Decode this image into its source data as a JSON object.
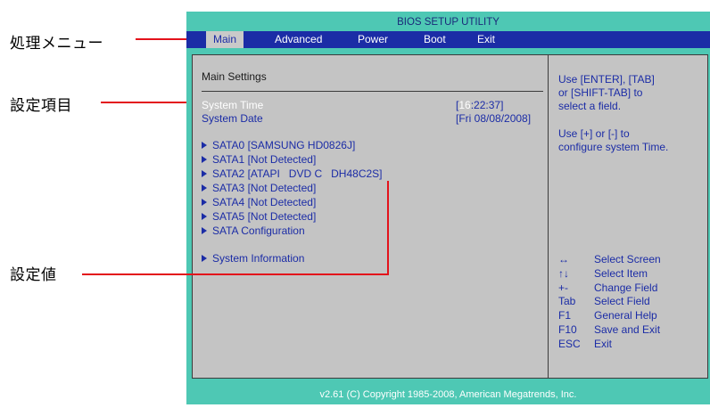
{
  "callouts": {
    "menu": "処理メニュー",
    "items": "設定項目",
    "values": "設定値"
  },
  "bios": {
    "title": "BIOS SETUP UTILITY",
    "menu": [
      "Main",
      "Advanced",
      "Power",
      "Boot",
      "Exit"
    ],
    "section_title": "Main Settings",
    "system_time_label": "System Time",
    "system_time_value_open": "[",
    "system_time_value_hl": "16",
    "system_time_value_rest": ":22:37]",
    "system_date_label": "System Date",
    "system_date_value": "[Fri 08/08/2008]",
    "submenus": [
      "SATA0 [SAMSUNG HD0826J]",
      "SATA1 [Not Detected]",
      "SATA2 [ATAPI   DVD C   DH48C2S]",
      "SATA3 [Not Detected]",
      "SATA4 [Not Detected]",
      "SATA5 [Not Detected]",
      "SATA Configuration"
    ],
    "system_information": "System Information",
    "help_lines": [
      "Use [ENTER], [TAB]",
      "or [SHIFT-TAB] to",
      "select a field.",
      "",
      "Use [+] or [-] to",
      "configure system Time."
    ],
    "keys": [
      {
        "key": "↔",
        "desc": "Select Screen"
      },
      {
        "key": "↑↓",
        "desc": "Select Item"
      },
      {
        "key": "+-",
        "desc": "Change Field"
      },
      {
        "key": "Tab",
        "desc": "Select Field"
      },
      {
        "key": "F1",
        "desc": "General Help"
      },
      {
        "key": "F10",
        "desc": "Save and Exit"
      },
      {
        "key": "ESC",
        "desc": "Exit"
      }
    ],
    "footer": "v2.61 (C) Copyright 1985-2008, American Megatrends, Inc."
  },
  "colors": {
    "frame": "#4ec8b4",
    "menu_bar": "#1b2ca6",
    "panel": "#c4c4c4",
    "callout_line": "#e3121b"
  }
}
